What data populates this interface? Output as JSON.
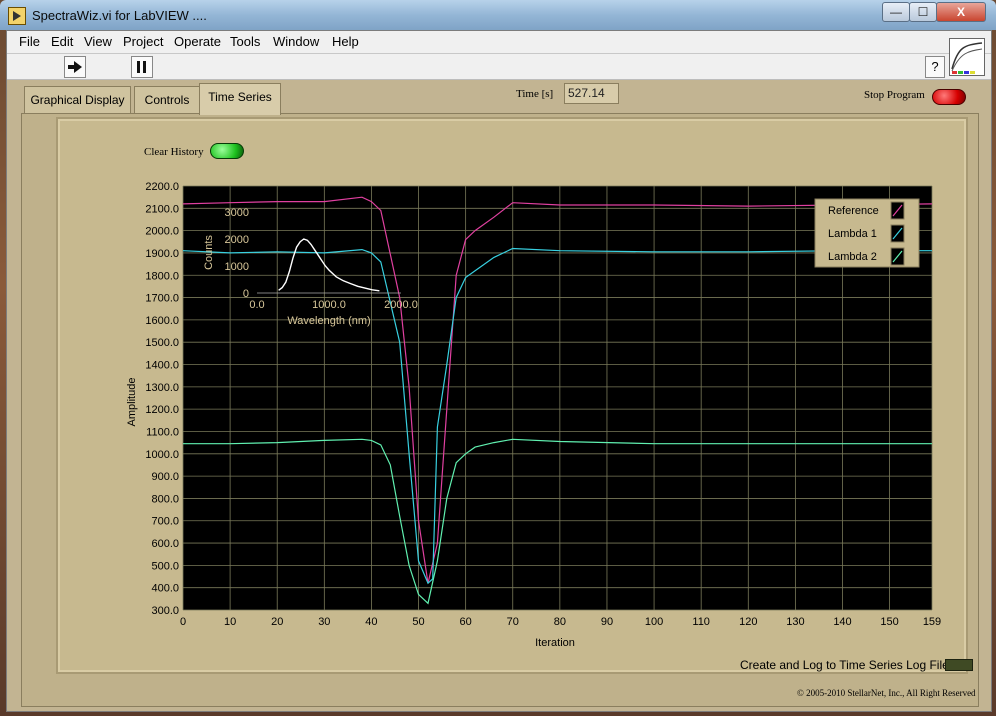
{
  "window": {
    "title": "SpectraWiz.vi for LabVIEW ....",
    "min_glyph": "—",
    "max_glyph": "☐",
    "close_glyph": "X"
  },
  "menu": [
    "File",
    "Edit",
    "View",
    "Project",
    "Operate",
    "Tools",
    "Window",
    "Help"
  ],
  "toolbar": {
    "run_icon": "run-arrow-icon",
    "pause_icon": "pause-icon",
    "help_glyph": "?"
  },
  "tabs": [
    {
      "label": "Graphical Display"
    },
    {
      "label": "Controls"
    },
    {
      "label": "Time Series",
      "active": true
    }
  ],
  "time": {
    "label": "Time [s]",
    "value": "527.14"
  },
  "stop": {
    "label": "Stop Program"
  },
  "clear": {
    "label": "Clear History"
  },
  "log": {
    "label": "Create and Log to Time Series Log File"
  },
  "copyright": "© 2005-2010 StellarNet, Inc., All Right Reserved",
  "colors": {
    "reference": "#e040a0",
    "lambda1": "#38d0e0",
    "lambda2": "#60f0b0",
    "plot_bg": "#000000",
    "grid": "#7a7a5a"
  },
  "chart_data": [
    {
      "type": "line",
      "xlabel": "Iteration",
      "ylabel": "Amplitude",
      "xlim": [
        0,
        159
      ],
      "ylim": [
        300,
        2200
      ],
      "xticks": [
        "0",
        "10",
        "20",
        "30",
        "40",
        "50",
        "60",
        "70",
        "80",
        "90",
        "100",
        "110",
        "120",
        "130",
        "140",
        "150",
        "159"
      ],
      "yticks": [
        "2200.0",
        "2100.0",
        "2000.0",
        "1900.0",
        "1800.0",
        "1700.0",
        "1600.0",
        "1500.0",
        "1400.0",
        "1300.0",
        "1200.0",
        "1100.0",
        "1000.0",
        "900.0",
        "800.0",
        "700.0",
        "600.0",
        "500.0",
        "400.0",
        "300.0"
      ],
      "legend": [
        "Reference",
        "Lambda 1",
        "Lambda 2"
      ],
      "legend_placement": "top-right",
      "grid": true,
      "series": [
        {
          "name": "Reference",
          "color": "#e040a0",
          "x": [
            0,
            10,
            20,
            30,
            38,
            40,
            42,
            46,
            48,
            50,
            52,
            54,
            56,
            58,
            60,
            62,
            66,
            70,
            80,
            100,
            120,
            140,
            159
          ],
          "y": [
            2120,
            2125,
            2130,
            2130,
            2150,
            2130,
            2090,
            1700,
            1300,
            700,
            420,
            600,
            1200,
            1800,
            1960,
            2000,
            2060,
            2125,
            2115,
            2115,
            2110,
            2115,
            2120
          ]
        },
        {
          "name": "Lambda 1",
          "color": "#38d0e0",
          "x": [
            0,
            10,
            20,
            30,
            38,
            40,
            42,
            46,
            48,
            50,
            52,
            53,
            54,
            56,
            58,
            60,
            62,
            66,
            70,
            80,
            100,
            120,
            140,
            159
          ],
          "y": [
            1910,
            1900,
            1905,
            1900,
            1915,
            1900,
            1860,
            1500,
            1000,
            520,
            420,
            440,
            1120,
            1400,
            1700,
            1790,
            1820,
            1880,
            1920,
            1910,
            1905,
            1905,
            1910,
            1910
          ]
        },
        {
          "name": "Lambda 2",
          "color": "#60f0b0",
          "x": [
            0,
            10,
            20,
            30,
            38,
            40,
            42,
            44,
            46,
            48,
            50,
            52,
            54,
            56,
            58,
            60,
            62,
            66,
            70,
            80,
            100,
            120,
            140,
            159
          ],
          "y": [
            1045,
            1045,
            1050,
            1060,
            1065,
            1060,
            1040,
            950,
            720,
            500,
            370,
            330,
            520,
            800,
            960,
            1000,
            1030,
            1050,
            1065,
            1055,
            1045,
            1045,
            1045,
            1045
          ]
        }
      ]
    },
    {
      "type": "line",
      "xlabel": "Wavelength (nm)",
      "ylabel": "Counts",
      "xlim": [
        0,
        2000
      ],
      "ylim": [
        0,
        3000
      ],
      "xticks": [
        "0.0",
        "1000.0",
        "2000.0"
      ],
      "yticks": [
        "3000",
        "2000",
        "1000",
        "0"
      ],
      "series": [
        {
          "color": "#ffffff",
          "x": [
            300,
            350,
            400,
            450,
            500,
            550,
            600,
            650,
            700,
            750,
            800,
            850,
            900,
            950,
            1000,
            1100,
            1200,
            1300,
            1400,
            1500,
            1600,
            1650,
            1700
          ],
          "y": [
            100,
            200,
            400,
            800,
            1300,
            1700,
            1900,
            2000,
            1950,
            1800,
            1600,
            1400,
            1200,
            1000,
            850,
            600,
            450,
            350,
            250,
            180,
            120,
            100,
            80
          ]
        }
      ]
    }
  ]
}
